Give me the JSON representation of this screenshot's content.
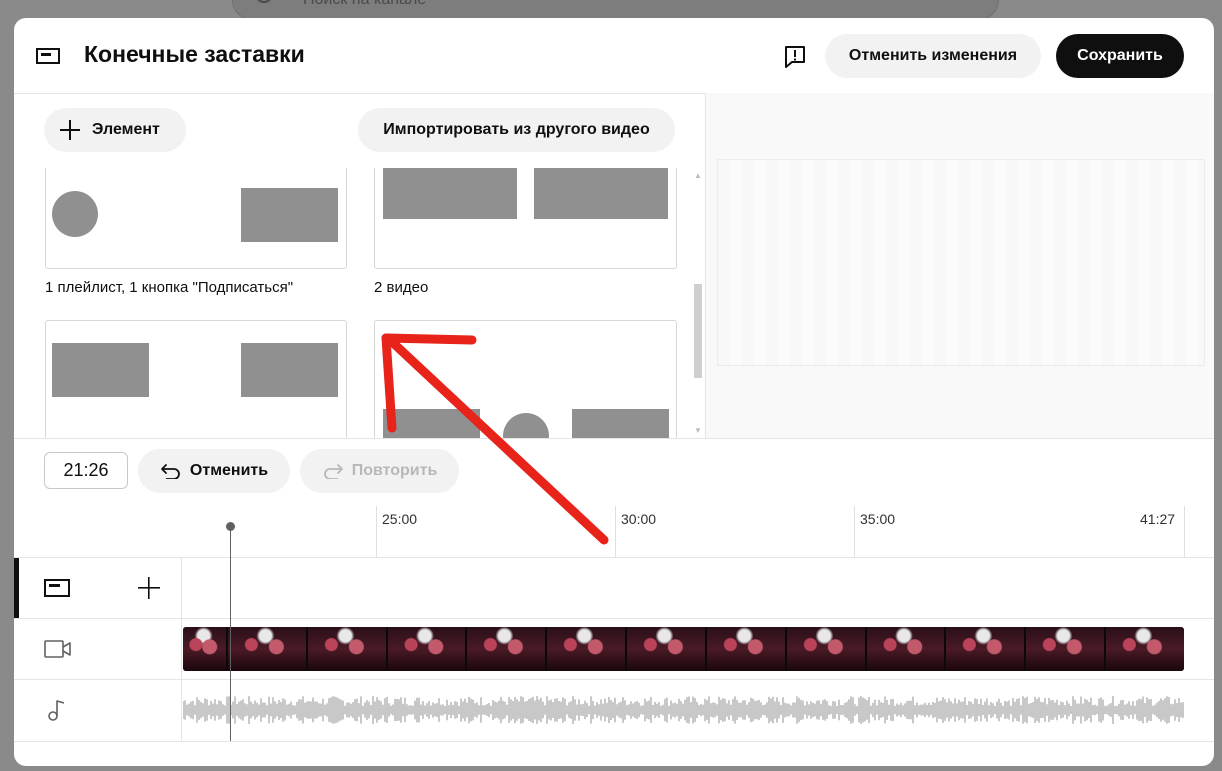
{
  "backdrop": {
    "search_placeholder": "Поиск на канале"
  },
  "header": {
    "title": "Конечные заставки",
    "discard_label": "Отменить изменения",
    "save_label": "Сохранить"
  },
  "toolbar": {
    "add_element_label": "Элемент",
    "import_label": "Импортировать из другого видео"
  },
  "templates": [
    {
      "label": "1 плейлист, 1 кнопка \"Подписаться\""
    },
    {
      "label": "2 видео"
    },
    {
      "label": ""
    },
    {
      "label": ""
    }
  ],
  "editor": {
    "current_time": "21:26",
    "undo_label": "Отменить",
    "redo_label": "Повторить"
  },
  "timeline": {
    "ticks": [
      "25:00",
      "30:00",
      "35:00",
      "41:27"
    ]
  },
  "colors": {
    "accent_arrow": "#e8231a",
    "save_bg": "#0f0f0f",
    "placeholder_gray": "#909090"
  }
}
